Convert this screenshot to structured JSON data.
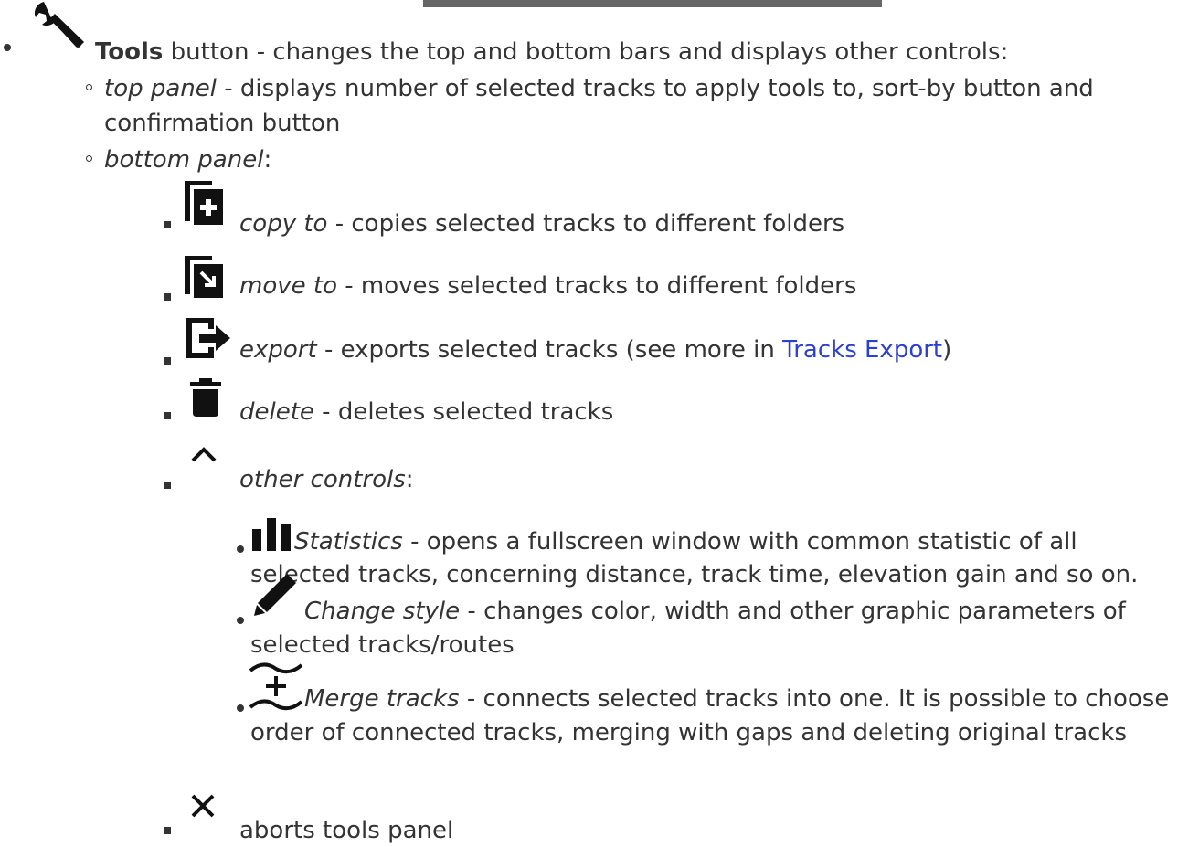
{
  "tools": {
    "name": "Tools",
    "desc": " button - changes the top and bottom bars and displays other controls:"
  },
  "top_panel": {
    "name": "top panel",
    "desc_line1": " - displays number of selected tracks to apply tools to, sort-by button and",
    "desc_line2": "confirmation button"
  },
  "bottom_panel": {
    "name": "bottom panel",
    "suffix": ":"
  },
  "items": {
    "copy": {
      "name": "copy to",
      "desc": " - copies selected tracks to different folders",
      "icon": "copy-to-icon"
    },
    "move": {
      "name": "move to",
      "desc": " - moves selected tracks to different folders",
      "icon": "move-to-icon"
    },
    "export": {
      "name": "export",
      "desc_before": " - exports selected tracks (see more in ",
      "link": "Tracks Export",
      "desc_after": ")",
      "icon": "export-icon"
    },
    "delete": {
      "name": "delete",
      "desc": " - deletes selected tracks",
      "icon": "trash-icon"
    },
    "other": {
      "name": "other controls",
      "suffix": ":",
      "icon": "chevron-up-icon"
    },
    "abort": {
      "desc": "aborts tools panel",
      "icon": "close-icon"
    }
  },
  "other_controls": {
    "statistics": {
      "name": "Statistics",
      "desc_line1": " - opens a fullscreen window with common statistic of all",
      "desc_line2": "selected tracks, concerning distance, track time, elevation gain and so on.",
      "icon": "bar-chart-icon"
    },
    "style": {
      "name": "Change style",
      "desc_line1": " - changes color, width and other graphic parameters of",
      "desc_line2": "selected tracks/routes",
      "icon": "pencil-icon"
    },
    "merge": {
      "name": "Merge tracks",
      "desc_line1": " - connects selected tracks into one. It is possible to choose",
      "desc_line2": "order of connected tracks, merging with gaps and deleting original tracks",
      "icon": "merge-tracks-icon"
    }
  },
  "colors": {
    "text": "#333333",
    "link": "#2b3fd1",
    "topbar": "#666666"
  }
}
